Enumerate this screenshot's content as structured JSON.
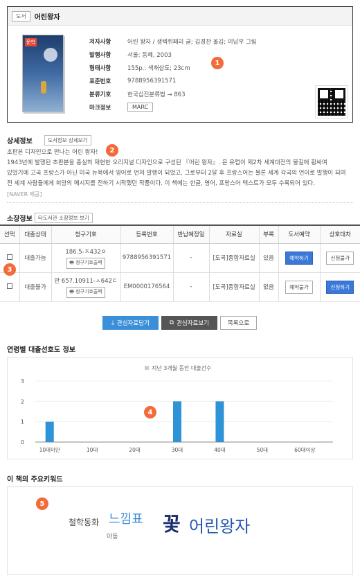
{
  "book": {
    "type_badge": "도서",
    "title": "어린왕자",
    "cover_label": "문학",
    "meta": [
      {
        "key": "저자사항",
        "value": "어린 왕자 / 생텍쥐페리 글; 김경찬 옮김; 이남우 그림"
      },
      {
        "key": "발행사항",
        "value": "서울: 동혜, 2003"
      },
      {
        "key": "형태사항",
        "value": "155p.: 색채삽도; 23cm"
      },
      {
        "key": "표준번호",
        "value": "9788956391571"
      },
      {
        "key": "분류기호",
        "value": "한국십진분류법 → 863"
      },
      {
        "key": "마크정보",
        "value": "MARC"
      }
    ]
  },
  "markers": [
    "1",
    "2",
    "3",
    "4",
    "5"
  ],
  "detail": {
    "title": "상세정보",
    "button": "도서정보 상세보기",
    "lines": [
      "초판본 디자인으로 만나는 어린 왕자!",
      "1943년에 발행된 초판본을 충실히 재현한 오리지널 디자인으로 구성된 『어린 왕자』. 은 유럽이 제2차 세계대전의 불길에 휩싸여",
      "있었기에 고국 프랑스가 아닌 미국 뉴욕에서 영어로 먼저 발행이 되었고, 그로부터 2달 후 프랑스어는 물론 세계 각국의 언어로 발행이 되며",
      "전 세계 사람들에게 희망의 메시지를 전하기 시작했던 작품이다. 이 책에는 한글, 영어, 프랑스어 텍스트가 모두 수록되어 있다."
    ],
    "source": "[NAVER 제공]"
  },
  "holdings": {
    "title": "소장정보",
    "button": "타도서관 소장정보 보기",
    "headers": [
      "선택",
      "대출상태",
      "청구기호",
      "등록번호",
      "반납예정일",
      "자료실",
      "부록",
      "도서예약",
      "상호대차"
    ],
    "print_label": "청구기호출력",
    "rows": [
      {
        "status": "대출가능",
        "callno": "186.5-ㅈ432ㅇ",
        "regno": "9788956391571",
        "due": "-",
        "room": "[도곡]종합자료실",
        "appendix": "있음",
        "reserve": "예약하기",
        "ill": "신청불가"
      },
      {
        "status": "대출불가",
        "callno": "만 657.10911-ㅅ642ㄷ",
        "regno": "EM0000176564",
        "due": "-",
        "room": "[도곡]종합자료실",
        "appendix": "없음",
        "reserve": "예약불가",
        "ill": "신청하기"
      }
    ]
  },
  "actions": {
    "add": "관심자료담기",
    "view": "관심자료보기",
    "list": "목록으로"
  },
  "chart": {
    "section_title": "연령별 대출선호도 정보"
  },
  "chart_data": {
    "type": "bar",
    "legend": "지난 3개월 동안 대출건수",
    "categories": [
      "10대미만",
      "10대",
      "20대",
      "30대",
      "40대",
      "50대",
      "60대이상"
    ],
    "values": [
      1,
      0,
      0,
      2,
      2,
      0,
      0
    ],
    "ylim": [
      0,
      3
    ],
    "yticks": [
      "0",
      "1",
      "2",
      "3"
    ],
    "bar_color": "#2f93d8"
  },
  "keywords": {
    "section_title": "이 책의 주요키워드",
    "items": [
      {
        "text": "철학동화",
        "color": "#444444"
      },
      {
        "text": "느낌표",
        "color": "#3a8fd6"
      },
      {
        "text": "아동",
        "color": "#666666"
      },
      {
        "text": "꽃",
        "color": "#1a2f6b"
      },
      {
        "text": "어린왕자",
        "color": "#2456b0"
      }
    ]
  }
}
